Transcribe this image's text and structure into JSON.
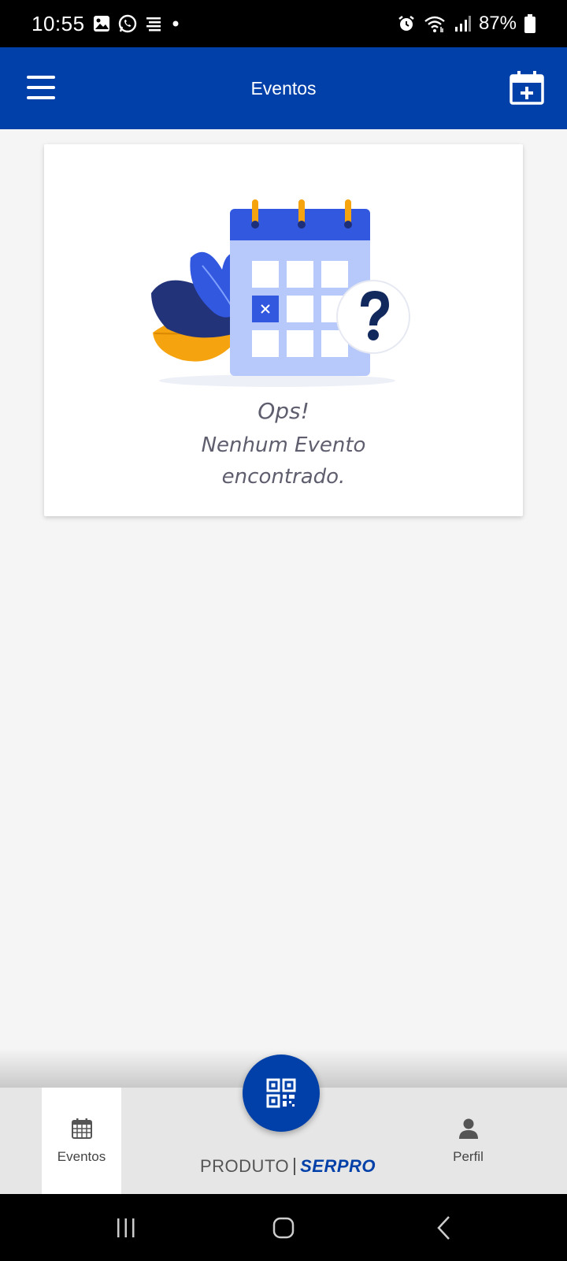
{
  "status_bar": {
    "time": "10:55",
    "battery": "87%",
    "left_icons": [
      "gallery-icon",
      "whatsapp-icon",
      "notes-icon",
      "dot-icon"
    ],
    "right_icons": [
      "alarm-icon",
      "wifi-icon",
      "signal-icon",
      "battery-icon"
    ]
  },
  "app_bar": {
    "title": "Eventos",
    "menu_icon": "menu-icon",
    "action_icon": "calendar-add-icon"
  },
  "empty_state": {
    "title": "Ops!",
    "line1": "Nenhum Evento",
    "line2": "encontrado.",
    "illustration": "calendar-question-illustration"
  },
  "bottom_nav": {
    "items": [
      {
        "label": "Eventos",
        "icon": "calendar-icon",
        "active": true
      },
      {
        "label": "Perfil",
        "icon": "person-icon",
        "active": false
      }
    ],
    "fab_icon": "qr-code-icon",
    "brand_product": "PRODUTO",
    "brand_name": "SERPRO"
  },
  "colors": {
    "primary": "#0040a8",
    "accent_orange": "#f5a623",
    "background": "#f5f5f5",
    "text_muted": "#5e5e6e"
  }
}
